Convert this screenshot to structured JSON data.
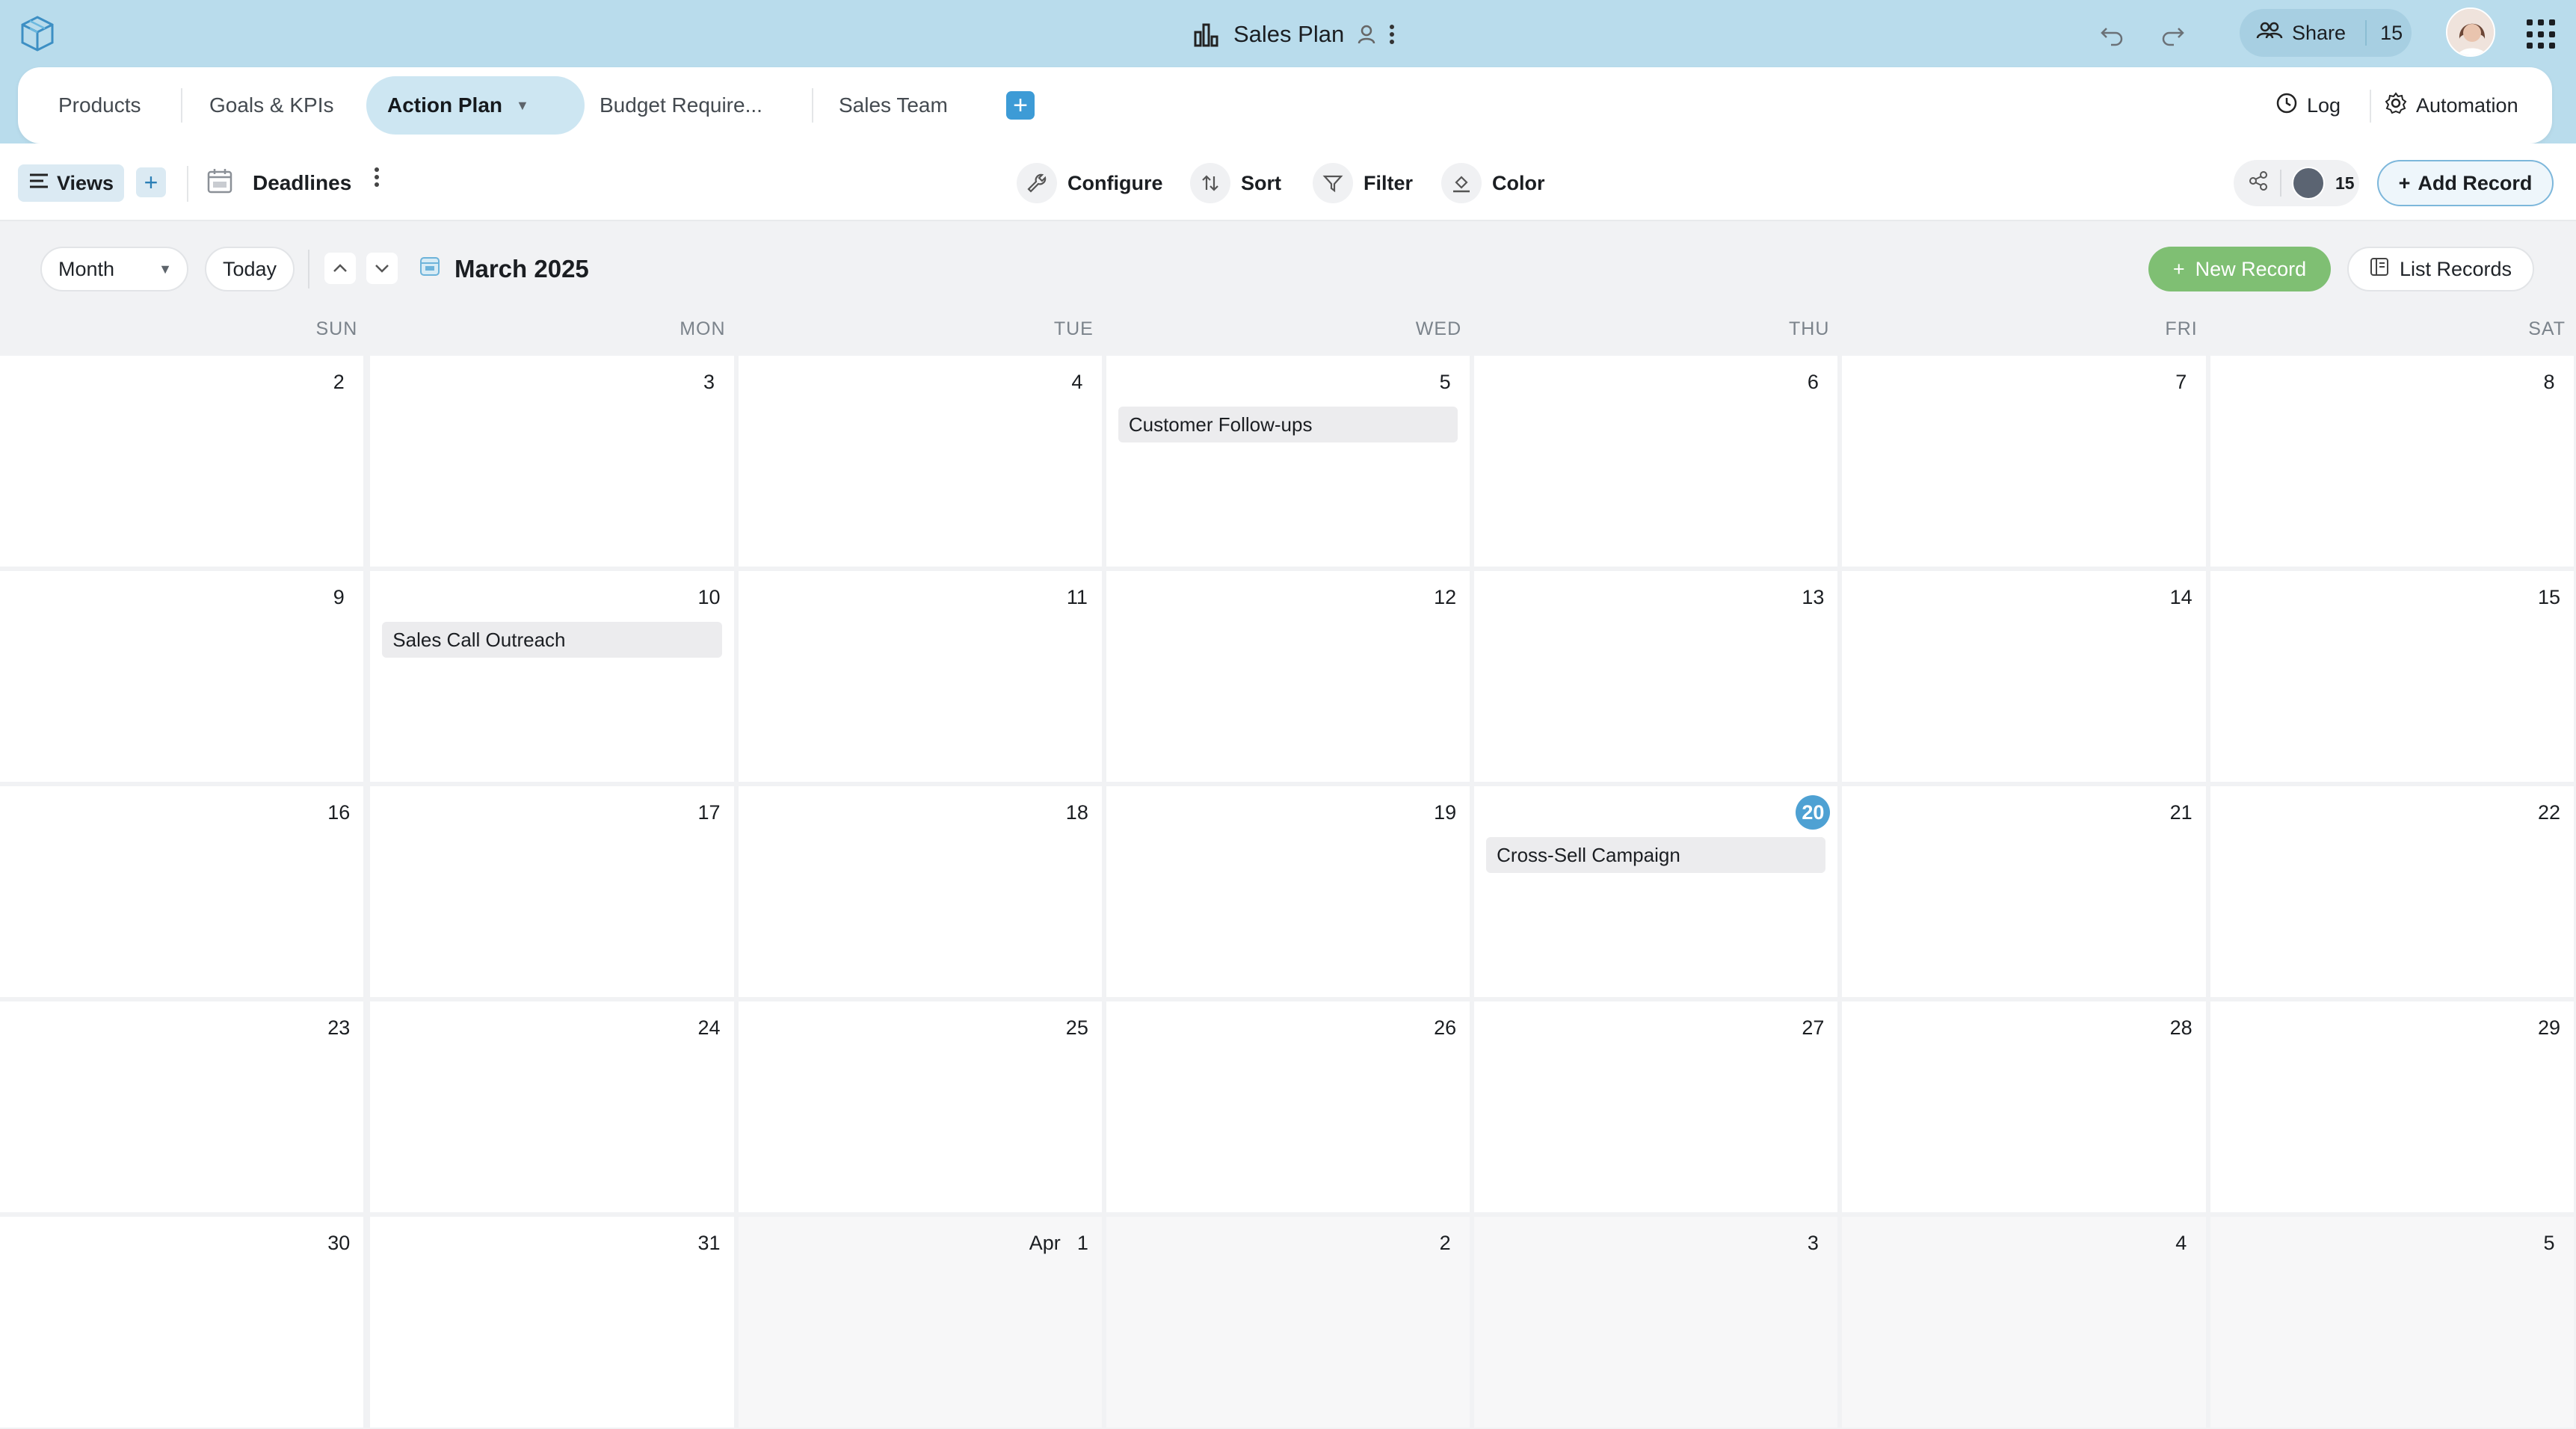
{
  "app": {
    "doc_title": "Sales Plan",
    "share_label": "Share",
    "share_count": "15"
  },
  "tabs": [
    {
      "label": "Products"
    },
    {
      "label": "Goals & KPIs"
    },
    {
      "label": "Action Plan"
    },
    {
      "label": "Budget Require..."
    },
    {
      "label": "Sales Team"
    }
  ],
  "tabs_right": {
    "log": "Log",
    "automation": "Automation"
  },
  "toolbar": {
    "views_label": "Views",
    "view_name": "Deadlines",
    "configure": "Configure",
    "sort": "Sort",
    "filter": "Filter",
    "color": "Color",
    "collaborators_count": "15",
    "add_record": "Add Record"
  },
  "calendar": {
    "mode": "Month",
    "today_label": "Today",
    "title": "March 2025",
    "new_record": "New Record",
    "list_records": "List Records",
    "weekdays": [
      "SUN",
      "MON",
      "TUE",
      "WED",
      "THU",
      "FRI",
      "SAT"
    ],
    "weeks": [
      [
        "2",
        "3",
        "4",
        "5",
        "6",
        "7",
        "8"
      ],
      [
        "9",
        "10",
        "11",
        "12",
        "13",
        "14",
        "15"
      ],
      [
        "16",
        "17",
        "18",
        "19",
        "20",
        "21",
        "22"
      ],
      [
        "23",
        "24",
        "25",
        "26",
        "27",
        "28",
        "29"
      ],
      [
        "30",
        "31",
        "1",
        "2",
        "3",
        "4",
        "5"
      ]
    ],
    "apr_prefix": "Apr",
    "events": [
      {
        "week": 0,
        "day": 3,
        "title": "Customer Follow-ups"
      },
      {
        "week": 1,
        "day": 1,
        "title": "Sales Call Outreach"
      },
      {
        "week": 2,
        "day": 4,
        "title": "Cross-Sell Campaign"
      }
    ],
    "today": {
      "week": 2,
      "day": 4
    }
  },
  "icons": {
    "logo": "cube-logo-icon",
    "chart": "bar-chart-icon",
    "undo": "undo-icon",
    "redo": "redo-icon",
    "apps": "apps-grid-icon"
  },
  "colors": {
    "topbar_bg": "#b9dcec",
    "accent": "#4ea1d3",
    "new_record": "#7fbf73"
  }
}
